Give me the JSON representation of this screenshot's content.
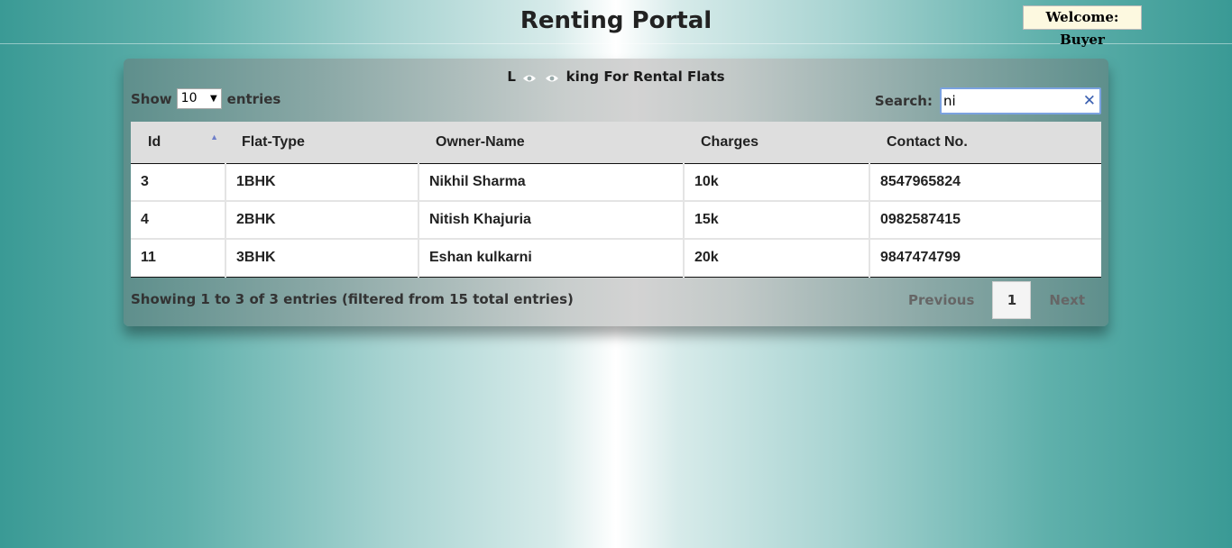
{
  "header": {
    "title": "Renting Portal",
    "welcome": "Welcome: Buyer"
  },
  "panel": {
    "heading_prefix": "L",
    "heading_suffix": "king For Rental Flats",
    "heading_icons": [
      "eye-icon",
      "eye-icon"
    ],
    "length": {
      "label_before": "Show",
      "value": "10",
      "label_after": "entries"
    },
    "search": {
      "label": "Search:",
      "value": "ni",
      "clear_icon": "close-icon"
    }
  },
  "table": {
    "columns": [
      "Id",
      "Flat-Type",
      "Owner-Name",
      "Charges",
      "Contact No."
    ],
    "sorted_column": "Id",
    "sort_direction": "asc",
    "rows": [
      [
        "3",
        "1BHK",
        "Nikhil Sharma",
        "10k",
        "8547965824"
      ],
      [
        "4",
        "2BHK",
        "Nitish Khajuria",
        "15k",
        "0982587415"
      ],
      [
        "11",
        "3BHK",
        "Eshan kulkarni",
        "20k",
        "9847474799"
      ]
    ]
  },
  "footer": {
    "info": "Showing 1 to 3 of 3 entries (filtered from 15 total entries)",
    "pagination": {
      "previous": "Previous",
      "current": "1",
      "next": "Next"
    }
  }
}
